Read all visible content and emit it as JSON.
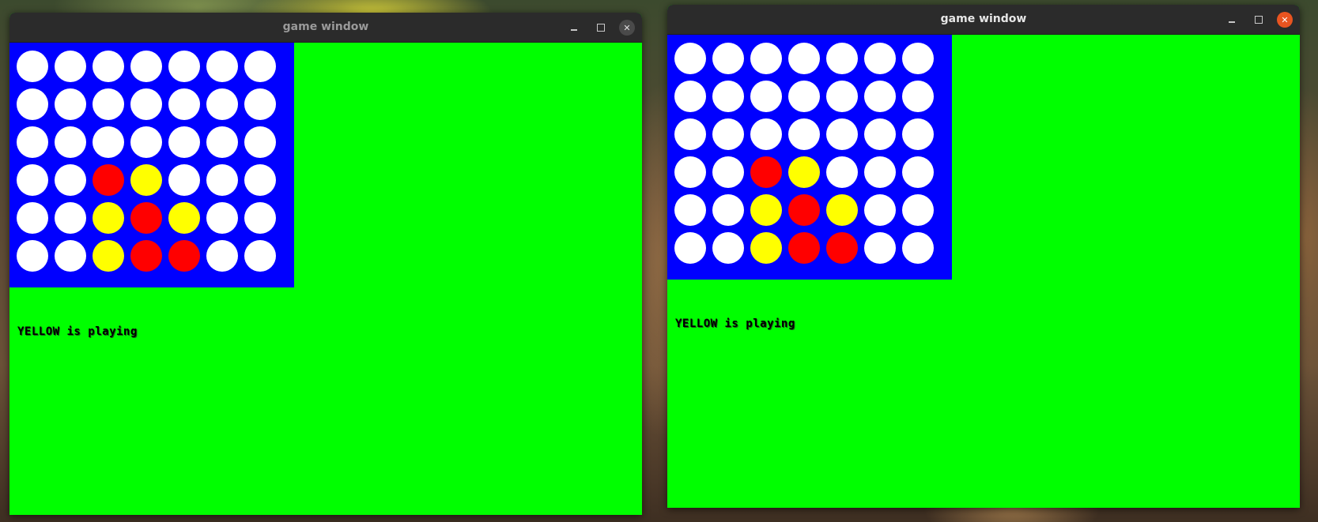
{
  "colors": {
    "board": "#0000ff",
    "background": "#00ff00",
    "empty": "#ffffff",
    "red": "#ff0000",
    "yellow": "#ffff00",
    "close_active": "#e95420"
  },
  "windows": [
    {
      "title": "game window",
      "active": false,
      "status_text": "YELLOW is playing",
      "board": [
        [
          "empty",
          "empty",
          "empty",
          "empty",
          "empty",
          "empty",
          "empty"
        ],
        [
          "empty",
          "empty",
          "empty",
          "empty",
          "empty",
          "empty",
          "empty"
        ],
        [
          "empty",
          "empty",
          "empty",
          "empty",
          "empty",
          "empty",
          "empty"
        ],
        [
          "empty",
          "empty",
          "red",
          "yellow",
          "empty",
          "empty",
          "empty"
        ],
        [
          "empty",
          "empty",
          "yellow",
          "red",
          "yellow",
          "empty",
          "empty"
        ],
        [
          "empty",
          "empty",
          "yellow",
          "red",
          "red",
          "empty",
          "empty"
        ]
      ],
      "controls": {
        "minimize": "minimize-icon",
        "maximize": "maximize-icon",
        "close": "close-icon"
      }
    },
    {
      "title": "game window",
      "active": true,
      "status_text": "YELLOW is playing",
      "board": [
        [
          "empty",
          "empty",
          "empty",
          "empty",
          "empty",
          "empty",
          "empty"
        ],
        [
          "empty",
          "empty",
          "empty",
          "empty",
          "empty",
          "empty",
          "empty"
        ],
        [
          "empty",
          "empty",
          "empty",
          "empty",
          "empty",
          "empty",
          "empty"
        ],
        [
          "empty",
          "empty",
          "red",
          "yellow",
          "empty",
          "empty",
          "empty"
        ],
        [
          "empty",
          "empty",
          "yellow",
          "red",
          "yellow",
          "empty",
          "empty"
        ],
        [
          "empty",
          "empty",
          "yellow",
          "red",
          "red",
          "empty",
          "empty"
        ]
      ],
      "controls": {
        "minimize": "minimize-icon",
        "maximize": "maximize-icon",
        "close": "close-icon"
      }
    }
  ]
}
